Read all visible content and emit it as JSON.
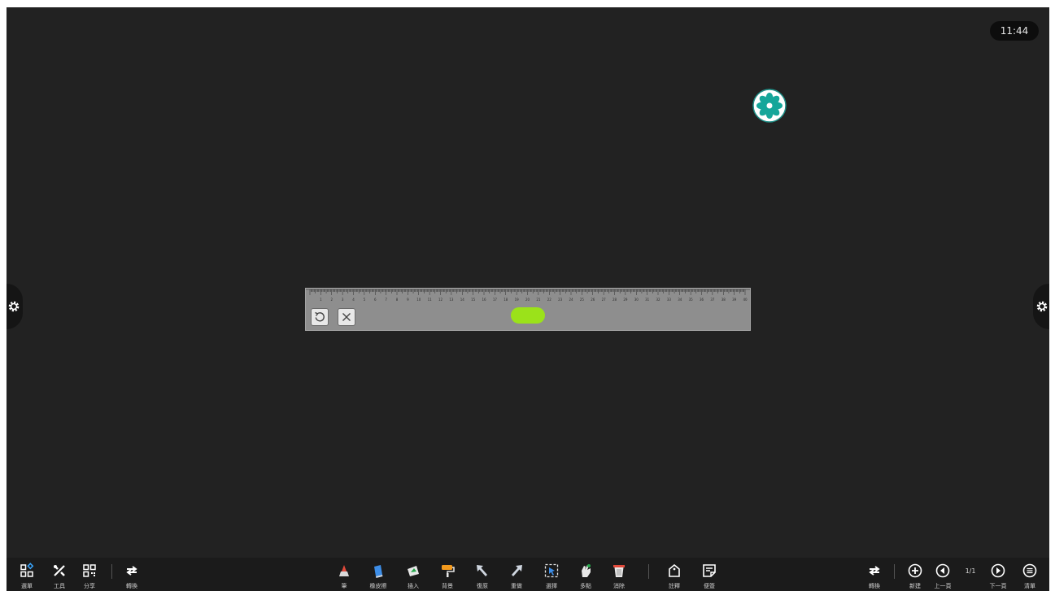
{
  "status": {
    "clock": "11:44"
  },
  "ruler": {
    "tick_labels": [
      "1",
      "2",
      "3",
      "4",
      "5",
      "6",
      "7",
      "8",
      "9",
      "10",
      "11",
      "12",
      "13",
      "14",
      "15",
      "16",
      "17",
      "18",
      "19",
      "20",
      "21",
      "22",
      "23",
      "24",
      "25",
      "26",
      "27",
      "28",
      "29",
      "30",
      "31",
      "32",
      "33",
      "34",
      "35",
      "36",
      "37",
      "38",
      "39",
      "40"
    ],
    "accent_color": "#9be21a"
  },
  "toolbar": {
    "left": [
      {
        "label": "選單",
        "icon": "menu-grid-icon"
      },
      {
        "label": "工具",
        "icon": "tools-icon"
      },
      {
        "label": "分享",
        "icon": "qr-share-icon"
      },
      {
        "label": "轉換",
        "icon": "switch-icon"
      }
    ],
    "center": [
      {
        "label": "筆",
        "icon": "pen-icon"
      },
      {
        "label": "橡皮擦",
        "icon": "eraser-icon"
      },
      {
        "label": "插入",
        "icon": "insert-icon"
      },
      {
        "label": "背景",
        "icon": "background-roller-icon"
      },
      {
        "label": "復原",
        "icon": "undo-arrow-icon"
      },
      {
        "label": "重做",
        "icon": "redo-arrow-icon"
      },
      {
        "label": "選擇",
        "icon": "select-icon"
      },
      {
        "label": "多點",
        "icon": "multi-touch-icon"
      },
      {
        "label": "消除",
        "icon": "clear-bin-icon"
      },
      {
        "label": "註釋",
        "icon": "annotate-icon"
      },
      {
        "label": "便簽",
        "icon": "sticky-note-icon"
      }
    ],
    "right": [
      {
        "label": "轉換",
        "icon": "switch-icon"
      },
      {
        "label": "新建",
        "icon": "new-page-icon"
      },
      {
        "label": "上一頁",
        "icon": "prev-page-icon"
      },
      {
        "label": "下一頁",
        "icon": "next-page-icon"
      },
      {
        "label": "清單",
        "icon": "list-icon"
      }
    ],
    "page_indicator": "1/1"
  }
}
